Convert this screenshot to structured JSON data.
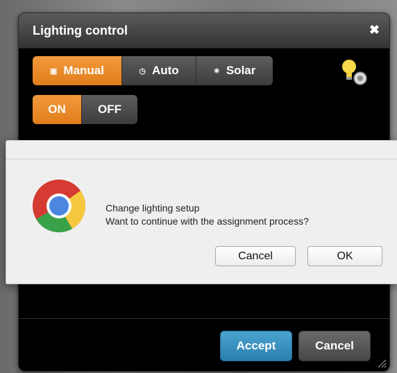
{
  "window": {
    "title": "Lighting control",
    "close_glyph": "✖"
  },
  "mode_buttons": [
    {
      "label": "Manual",
      "icon": "battery-icon",
      "active": true
    },
    {
      "label": "Auto",
      "icon": "clock-icon",
      "active": false
    },
    {
      "label": "Solar",
      "icon": "sun-icon",
      "active": false
    }
  ],
  "power_buttons": [
    {
      "label": "ON",
      "active": true
    },
    {
      "label": "OFF",
      "active": false
    }
  ],
  "footer": {
    "accept_label": "Accept",
    "cancel_label": "Cancel"
  },
  "dialog": {
    "title": "Change lighting setup",
    "message": "Want to continue with the assignment process?",
    "cancel_label": "Cancel",
    "ok_label": "OK"
  },
  "colors": {
    "active_orange": "#e98a26",
    "accept_blue": "#2b7fb0",
    "panel_bg": "#000000"
  }
}
